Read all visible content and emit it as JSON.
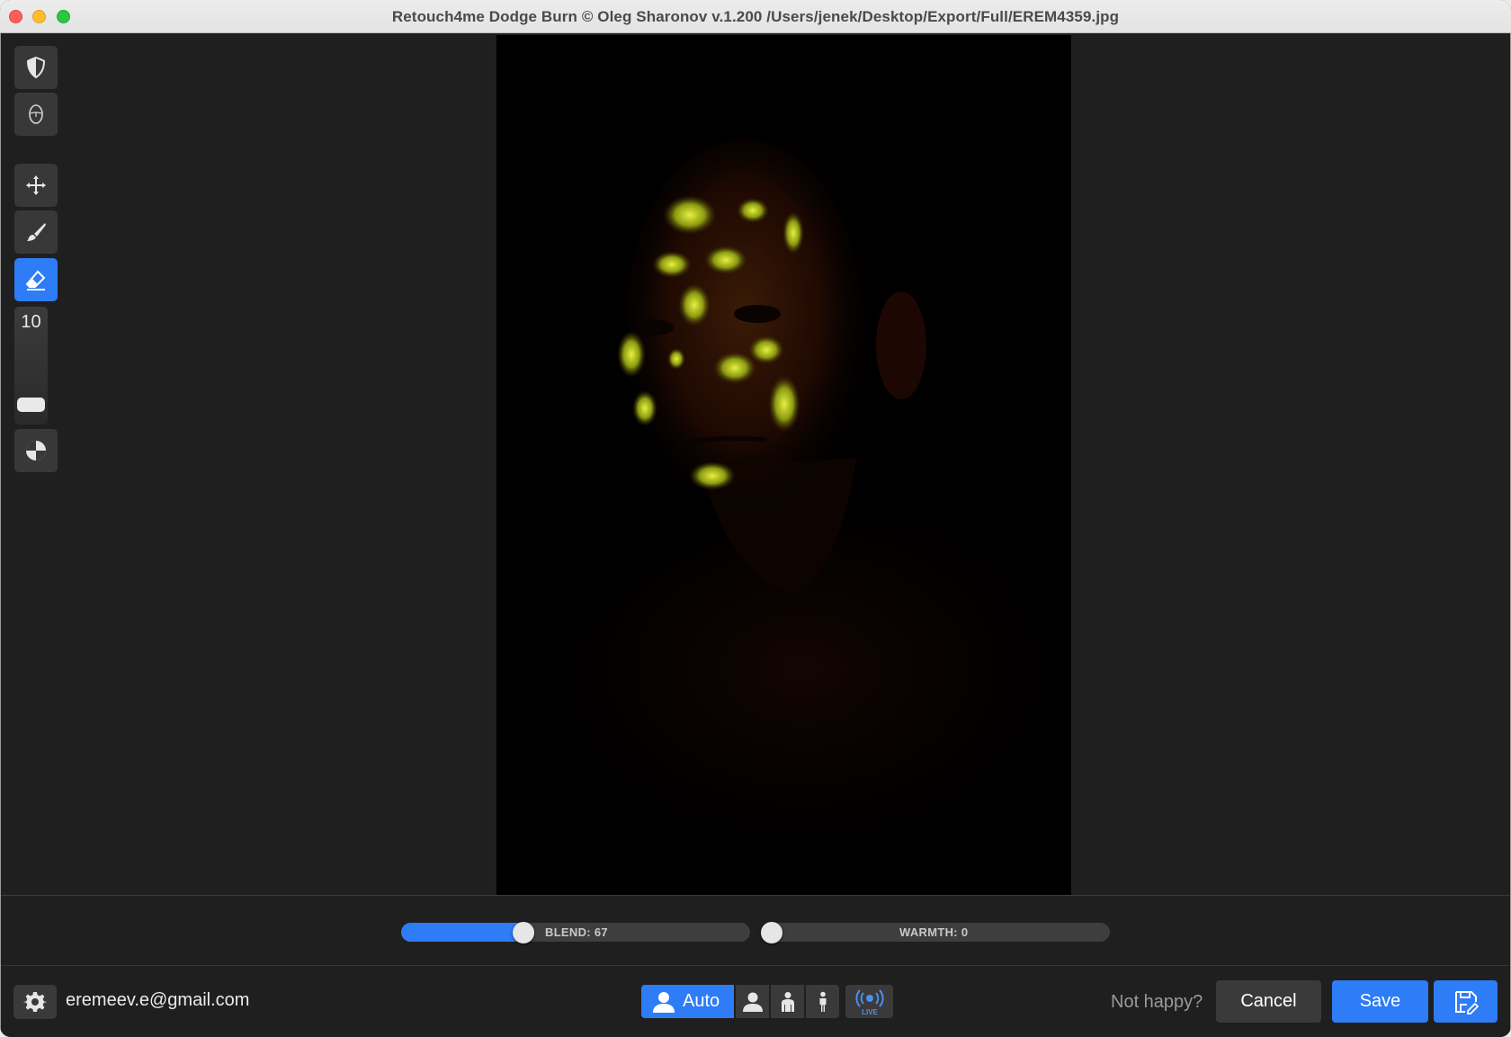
{
  "window": {
    "title": "Retouch4me Dodge Burn © Oleg Sharonov v.1.200 /Users/jenek/Desktop/Export/Full/EREM4359.jpg"
  },
  "toolbar": {
    "tools": [
      {
        "name": "mask-tool",
        "icon": "half-shield-icon"
      },
      {
        "name": "face-tool",
        "icon": "face-outline-icon"
      },
      {
        "name": "move-tool",
        "icon": "move-arrows-icon"
      },
      {
        "name": "brush-tool",
        "icon": "brush-icon"
      },
      {
        "name": "eraser-tool",
        "icon": "eraser-icon",
        "active": true
      },
      {
        "name": "contrast-tool",
        "icon": "contrast-circle-icon"
      }
    ],
    "brush_size": "10",
    "accent_color": "#2e7cf6"
  },
  "sliders": {
    "blend": {
      "label": "BLEND: 67",
      "value": 67
    },
    "warmth": {
      "label": "WARMTH: 0",
      "value": 0
    }
  },
  "footer": {
    "account_email": "eremeev.e@gmail.com",
    "mode_auto_label": "Auto",
    "live_label": "LIVE",
    "not_happy_label": "Not happy?",
    "cancel_label": "Cancel",
    "save_label": "Save"
  }
}
